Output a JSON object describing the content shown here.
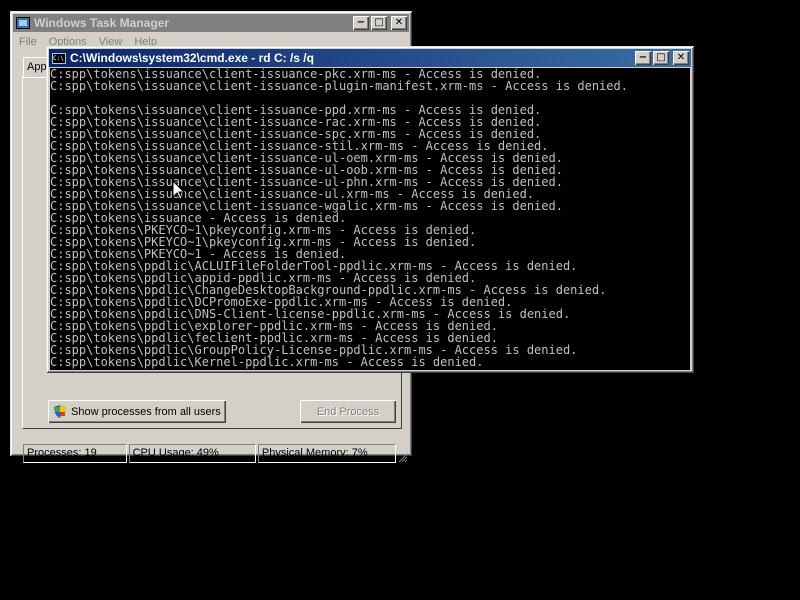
{
  "task_manager": {
    "title": "Windows Task Manager",
    "menu": [
      "File",
      "Options",
      "View",
      "Help"
    ],
    "tab": "App",
    "buttons": {
      "show_all": "Show processes from all users",
      "end_process": "End Process"
    },
    "status": {
      "processes": "Processes: 19",
      "cpu": "CPU Usage: 49%",
      "memory": "Physical Memory: 7%"
    }
  },
  "cmd": {
    "title": "C:\\Windows\\system32\\cmd.exe - rd  C: /s /q",
    "lines": [
      "C:spp\\tokens\\issuance\\client-issuance-pkc.xrm-ms - Access is denied.",
      "C:spp\\tokens\\issuance\\client-issuance-plugin-manifest.xrm-ms - Access is denied.",
      "",
      "C:spp\\tokens\\issuance\\client-issuance-ppd.xrm-ms - Access is denied.",
      "C:spp\\tokens\\issuance\\client-issuance-rac.xrm-ms - Access is denied.",
      "C:spp\\tokens\\issuance\\client-issuance-spc.xrm-ms - Access is denied.",
      "C:spp\\tokens\\issuance\\client-issuance-stil.xrm-ms - Access is denied.",
      "C:spp\\tokens\\issuance\\client-issuance-ul-oem.xrm-ms - Access is denied.",
      "C:spp\\tokens\\issuance\\client-issuance-ul-oob.xrm-ms - Access is denied.",
      "C:spp\\tokens\\issuance\\client-issuance-ul-phn.xrm-ms - Access is denied.",
      "C:spp\\tokens\\issuance\\client-issuance-ul.xrm-ms - Access is denied.",
      "C:spp\\tokens\\issuance\\client-issuance-wgalic.xrm-ms - Access is denied.",
      "C:spp\\tokens\\issuance - Access is denied.",
      "C:spp\\tokens\\PKEYCO~1\\pkeyconfig.xrm-ms - Access is denied.",
      "C:spp\\tokens\\PKEYCO~1\\pkeyconfig.xrm-ms - Access is denied.",
      "C:spp\\tokens\\PKEYCO~1 - Access is denied.",
      "C:spp\\tokens\\ppdlic\\ACLUIFileFolderTool-ppdlic.xrm-ms - Access is denied.",
      "C:spp\\tokens\\ppdlic\\appid-ppdlic.xrm-ms - Access is denied.",
      "C:spp\\tokens\\ppdlic\\ChangeDesktopBackground-ppdlic.xrm-ms - Access is denied.",
      "C:spp\\tokens\\ppdlic\\DCPromoExe-ppdlic.xrm-ms - Access is denied.",
      "C:spp\\tokens\\ppdlic\\DNS-Client-license-ppdlic.xrm-ms - Access is denied.",
      "C:spp\\tokens\\ppdlic\\explorer-ppdlic.xrm-ms - Access is denied.",
      "C:spp\\tokens\\ppdlic\\feclient-ppdlic.xrm-ms - Access is denied.",
      "C:spp\\tokens\\ppdlic\\GroupPolicy-License-ppdlic.xrm-ms - Access is denied.",
      "C:spp\\tokens\\ppdlic\\Kernel-ppdlic.xrm-ms - Access is denied."
    ]
  },
  "colors": {
    "desktop": "#000000",
    "window_face": "#d4d0c8",
    "active_title_start": "#0a246a",
    "active_title_end": "#3a6ea5",
    "inactive_title": "#808080",
    "console_text": "#c0c0c0"
  },
  "icons": [
    "task-manager-icon",
    "cmd-icon",
    "minimize-icon",
    "maximize-icon",
    "close-icon",
    "uac-shield-icon",
    "mouse-pointer-icon"
  ]
}
